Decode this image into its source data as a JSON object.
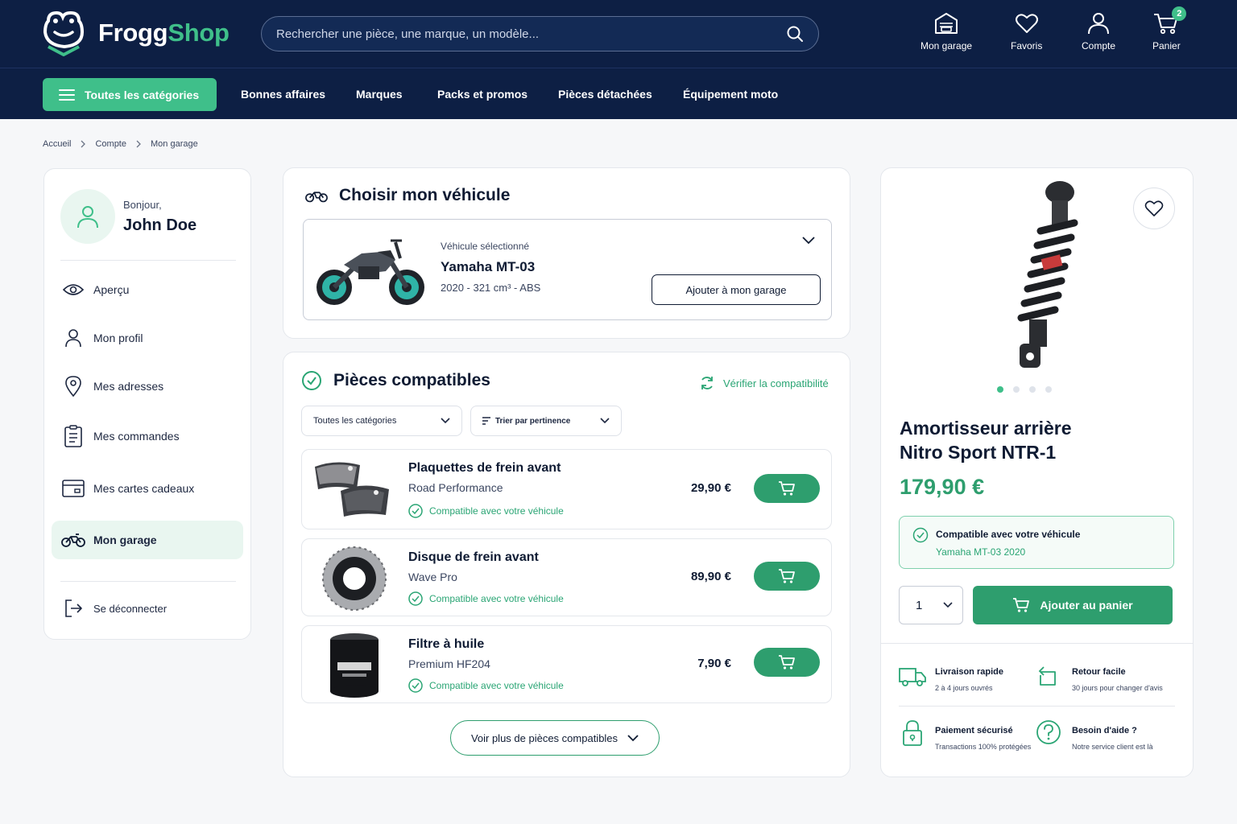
{
  "header": {
    "logo_frogg": "Frogg",
    "logo_shop": "Shop",
    "search_placeholder": "Rechercher une pièce, une marque, un modèle...",
    "icons": [
      {
        "label": "Mon garage",
        "icon": "garage-icon"
      },
      {
        "label": "Favoris",
        "icon": "heart-icon"
      },
      {
        "label": "Compte",
        "icon": "user-icon"
      },
      {
        "label": "Panier",
        "icon": "cart-icon"
      }
    ],
    "cart_count": "2"
  },
  "nav": {
    "categories_label": "Toutes les catégories",
    "links": [
      "Bonnes affaires",
      "Marques",
      "Packs et promos",
      "Pièces détachées",
      "Équipement moto"
    ]
  },
  "breadcrumb": [
    "Accueil",
    "Compte",
    "Mon garage"
  ],
  "sidebar": {
    "greeting": "Bonjour,",
    "username": "John Doe",
    "items": [
      {
        "label": "Aperçu",
        "icon": "eye-icon"
      },
      {
        "label": "Mon profil",
        "icon": "user-icon"
      },
      {
        "label": "Mes adresses",
        "icon": "location-pin-icon"
      },
      {
        "label": "Mes commandes",
        "icon": "clipboard-icon"
      },
      {
        "label": "Mes cartes cadeaux",
        "icon": "gift-card-icon"
      },
      {
        "label": "Mon garage",
        "icon": "motorcycle-icon",
        "active": true
      }
    ],
    "logout": "Se déconnecter"
  },
  "vehicle": {
    "title": "Choisir mon véhicule",
    "selected_label": "Véhicule sélectionné",
    "name": "Yamaha MT-03",
    "specs": "2020 - 321 cm³ - ABS",
    "add_button": "Ajouter à mon garage"
  },
  "parts": {
    "title": "Pièces compatibles",
    "verify": "Vérifier la compatibilité",
    "filter_category": "Toutes les catégories",
    "sort": "Trier par pertinence",
    "items": [
      {
        "name": "Plaquettes de frein avant",
        "brand": "Road Performance",
        "compat": "Compatible avec votre véhicule",
        "price": "29,90 €"
      },
      {
        "name": "Disque de frein avant",
        "brand": "Wave Pro",
        "compat": "Compatible avec votre véhicule",
        "price": "89,90 €"
      },
      {
        "name": "Filtre à huile",
        "brand": "Premium HF204",
        "compat": "Compatible avec votre véhicule",
        "price": "7,90 €"
      }
    ],
    "more_button": "Voir plus de pièces compatibles"
  },
  "product": {
    "title_line1": "Amortisseur arrière",
    "title_line2": "Nitro Sport NTR-1",
    "price": "179,90 €",
    "compat_title": "Compatible avec votre véhicule",
    "compat_vehicle": "Yamaha MT-03 2020",
    "qty": "1",
    "add_to_cart": "Ajouter au panier",
    "carousel_dots": 4,
    "carousel_active": 1,
    "features": [
      {
        "title": "Livraison rapide",
        "sub": "2 à 4 jours ouvrés",
        "icon": "truck-icon"
      },
      {
        "title": "Retour facile",
        "sub": "30 jours pour changer d'avis",
        "icon": "return-icon"
      },
      {
        "title": "Paiement sécurisé",
        "sub": "Transactions 100% protégées",
        "icon": "lock-icon"
      },
      {
        "title": "Besoin d'aide ?",
        "sub": "Notre service client est là",
        "icon": "help-icon"
      }
    ]
  },
  "colors": {
    "navy": "#0d1f44",
    "green": "#3fbf8a",
    "green_dark": "#2e9e6e"
  }
}
